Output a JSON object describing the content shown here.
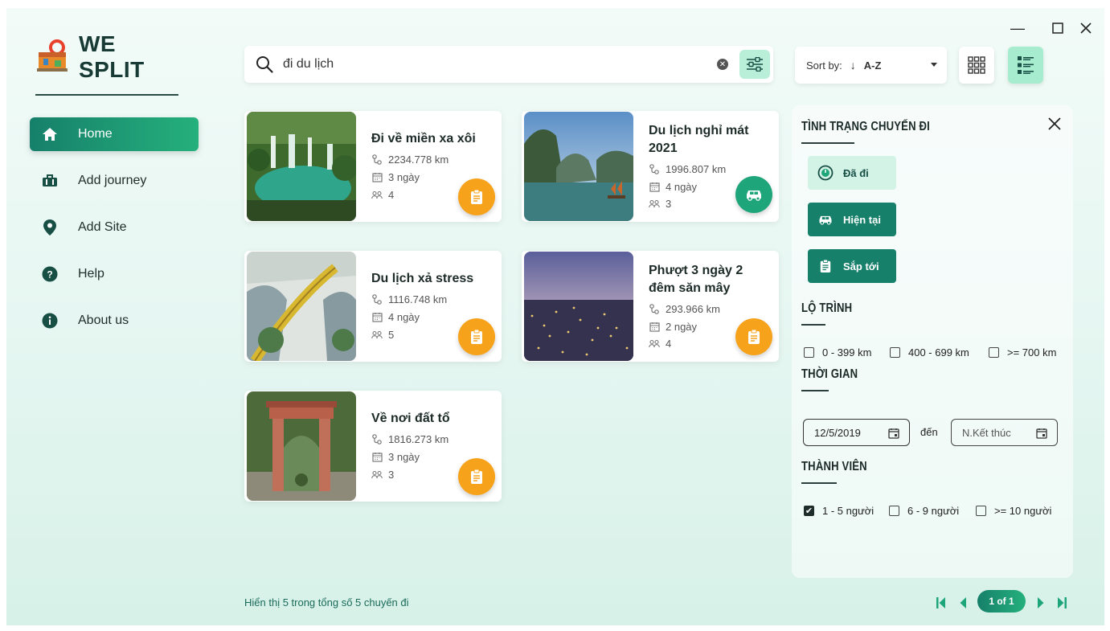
{
  "app": {
    "title": "WE SPLIT"
  },
  "window": {
    "minimize": "—",
    "maximize": "☐",
    "close": "✕"
  },
  "sidebar": {
    "items": [
      {
        "label": "Home",
        "icon": "home-icon",
        "active": true
      },
      {
        "label": "Add journey",
        "icon": "suitcase-icon",
        "active": false
      },
      {
        "label": "Add Site",
        "icon": "location-pin-icon",
        "active": false
      },
      {
        "label": "Help",
        "icon": "help-icon",
        "active": false
      },
      {
        "label": "About us",
        "icon": "info-icon",
        "active": false
      }
    ]
  },
  "search": {
    "value": "đi du lịch",
    "placeholder": ""
  },
  "sort": {
    "label": "Sort by:",
    "arrow": "↓",
    "value": "A-Z"
  },
  "trips": [
    {
      "name": "Đi về miền xa xôi",
      "distance": "2234.778 km",
      "days": "3 ngày",
      "members": "4",
      "status": "upcoming"
    },
    {
      "name": "Du lịch nghỉ mát 2021",
      "distance": "1996.807 km",
      "days": "4 ngày",
      "members": "3",
      "status": "current"
    },
    {
      "name": "Du lịch xả stress",
      "distance": "1116.748 km",
      "days": "4 ngày",
      "members": "5",
      "status": "upcoming"
    },
    {
      "name": "Phượt 3 ngày 2 đêm săn mây",
      "distance": "293.966 km",
      "days": "2 ngày",
      "members": "4",
      "status": "upcoming"
    },
    {
      "name": "Về nơi đất tổ",
      "distance": "1816.273 km",
      "days": "3 ngày",
      "members": "3",
      "status": "upcoming"
    }
  ],
  "filter": {
    "status_title": "TÌNH TRẠNG CHUYẾN ĐI",
    "status_buttons": [
      "Đã đi",
      "Hiện tại",
      "Sắp tới"
    ],
    "route_title": "LỘ TRÌNH",
    "route_options": [
      {
        "label": "0 - 399 km",
        "checked": false
      },
      {
        "label": "400 - 699 km",
        "checked": false
      },
      {
        "label": ">= 700 km",
        "checked": false
      }
    ],
    "time_title": "THỜI GIAN",
    "date_from": "12/5/2019",
    "date_sep": "đến",
    "date_to_placeholder": "N.Kết thúc",
    "member_title": "THÀNH VIÊN",
    "member_options": [
      {
        "label": "1 - 5 người",
        "checked": true
      },
      {
        "label": "6 - 9 người",
        "checked": false
      },
      {
        "label": ">= 10 người",
        "checked": false
      }
    ]
  },
  "footer": {
    "summary": "Hiển thị 5 trong tổng số 5 chuyến đi",
    "page": "1 of 1"
  },
  "colors": {
    "accent": "#1b9a74",
    "accent_dark": "#16806a",
    "orange": "#f7a21b",
    "status_light": "#d6f5ea"
  }
}
